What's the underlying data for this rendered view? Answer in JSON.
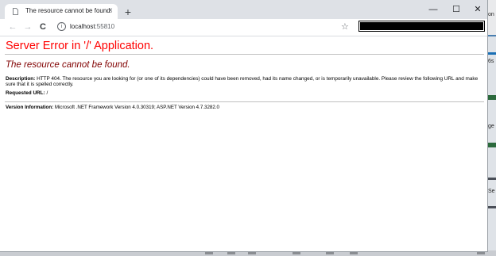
{
  "browser": {
    "tab_title": "The resource cannot be found.",
    "tab_close": "×",
    "new_tab": "+",
    "minimize": "—",
    "maximize": "☐",
    "close": "✕",
    "back": "←",
    "forward": "→",
    "reload": "C",
    "info_icon": "i",
    "url_host": "localhost",
    "url_port": ":55810",
    "star": "☆"
  },
  "page": {
    "heading": "Server Error in '/' Application.",
    "subheading": "The resource cannot be found.",
    "description_label": "Description:",
    "description_text": " HTTP 404. The resource you are looking for (or one of its dependencies) could have been removed, had its name changed, or is temporarily unavailable.  Please review the following URL and make sure that it is spelled correctly.",
    "requested_url_label": "Requested URL:",
    "requested_url_value": " /",
    "version_label": "Version Information:",
    "version_text": " Microsoft .NET Framework Version 4.0.30319; ASP.NET Version 4.7.3282.0"
  },
  "background": {
    "right_texts": [
      "on",
      "6s",
      "ge",
      "Se"
    ]
  }
}
